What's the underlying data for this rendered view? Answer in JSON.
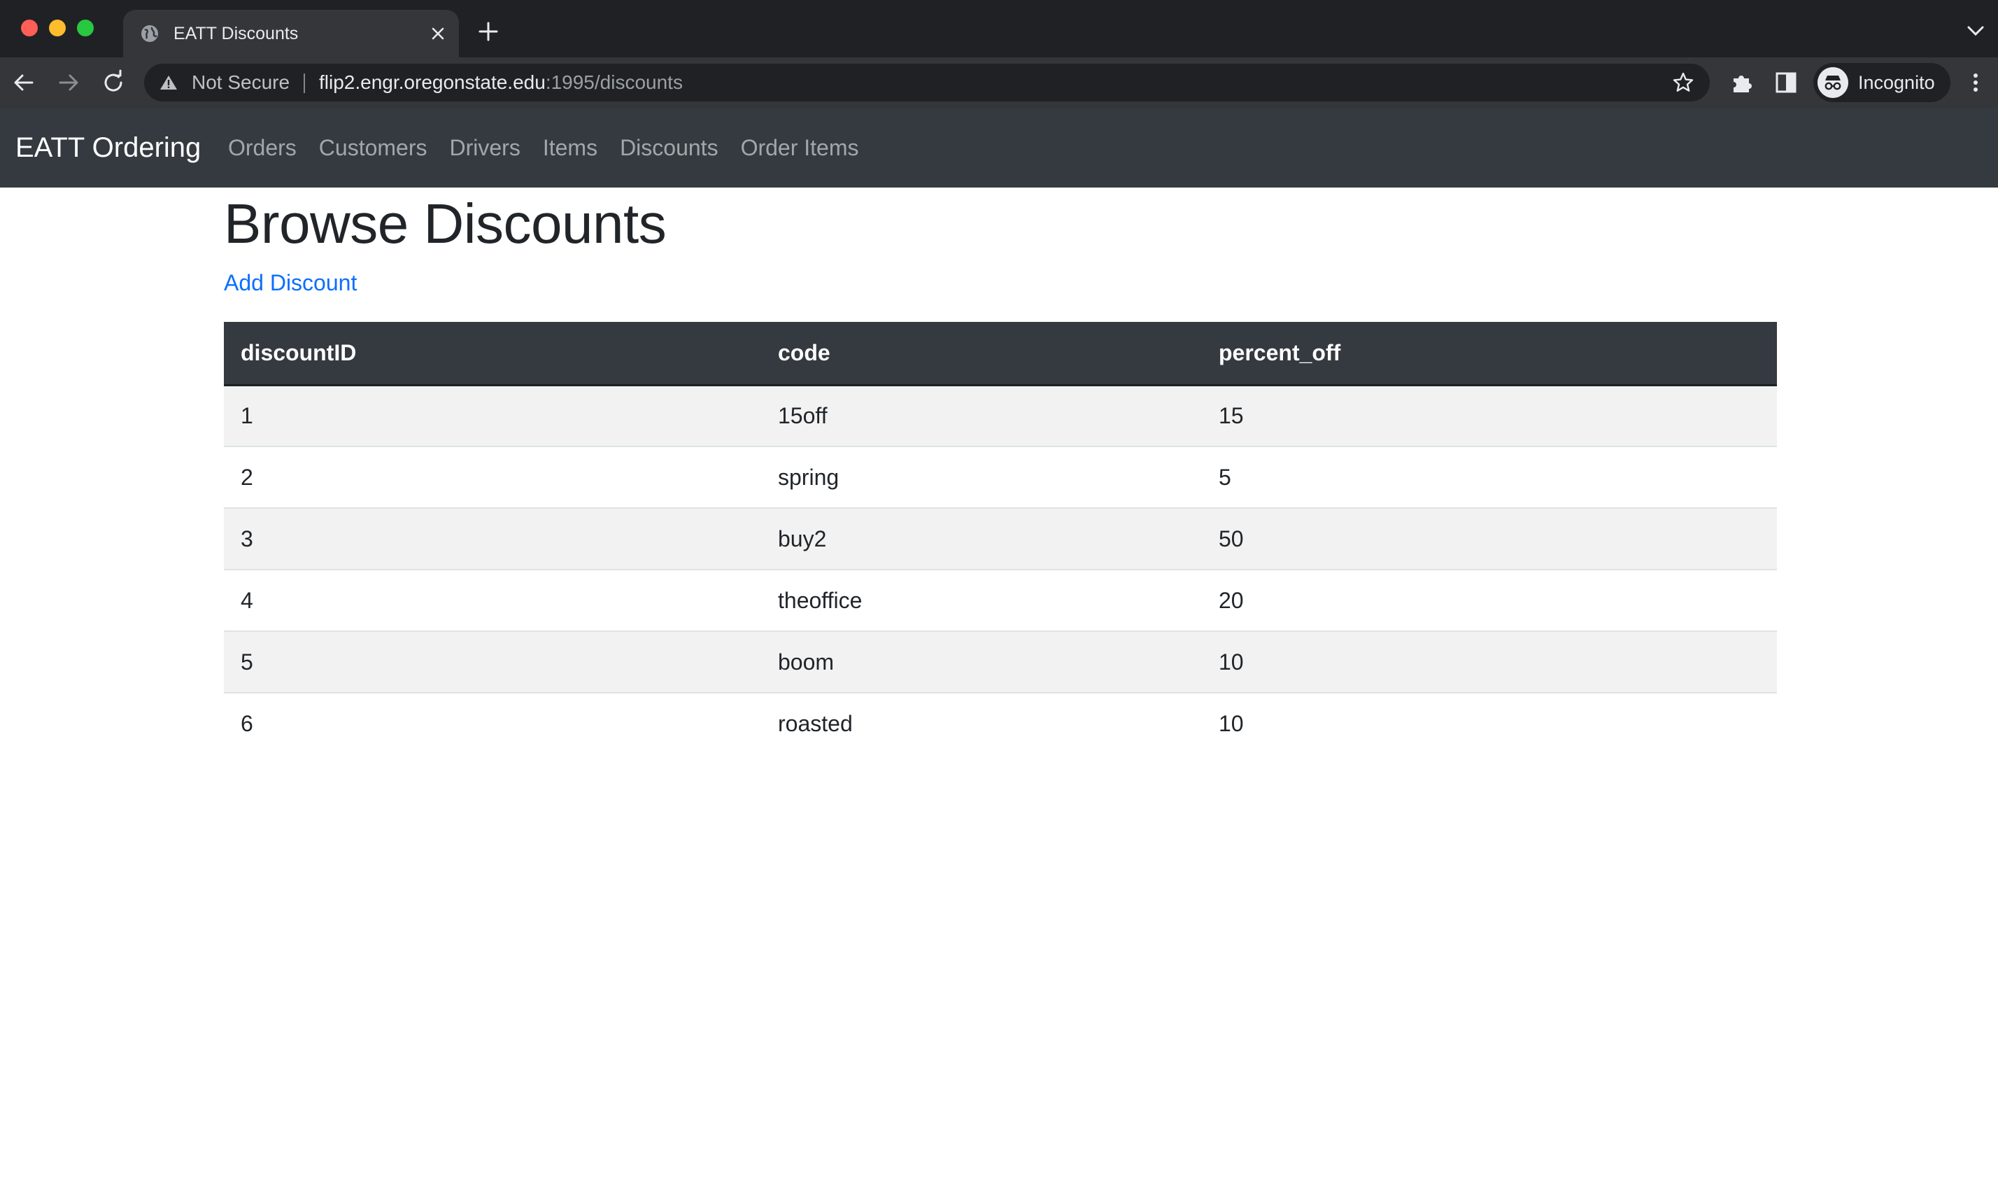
{
  "browser": {
    "tab_title": "EATT Discounts",
    "security_label": "Not Secure",
    "url_host": "flip2.engr.oregonstate.edu",
    "url_rest": ":1995/discounts",
    "profile_label": "Incognito"
  },
  "navbar": {
    "brand": "EATT Ordering",
    "links": [
      "Orders",
      "Customers",
      "Drivers",
      "Items",
      "Discounts",
      "Order Items"
    ]
  },
  "page": {
    "title": "Browse Discounts",
    "add_link": "Add Discount"
  },
  "table": {
    "headers": [
      "discountID",
      "code",
      "percent_off"
    ],
    "rows": [
      [
        "1",
        "15off",
        "15"
      ],
      [
        "2",
        "spring",
        "5"
      ],
      [
        "3",
        "buy2",
        "50"
      ],
      [
        "4",
        "theoffice",
        "20"
      ],
      [
        "5",
        "boom",
        "10"
      ],
      [
        "6",
        "roasted",
        "10"
      ]
    ]
  },
  "colors": {
    "navbar_bg": "#343a40",
    "link_blue": "#0d6efd",
    "stripe": "#f2f2f2"
  }
}
